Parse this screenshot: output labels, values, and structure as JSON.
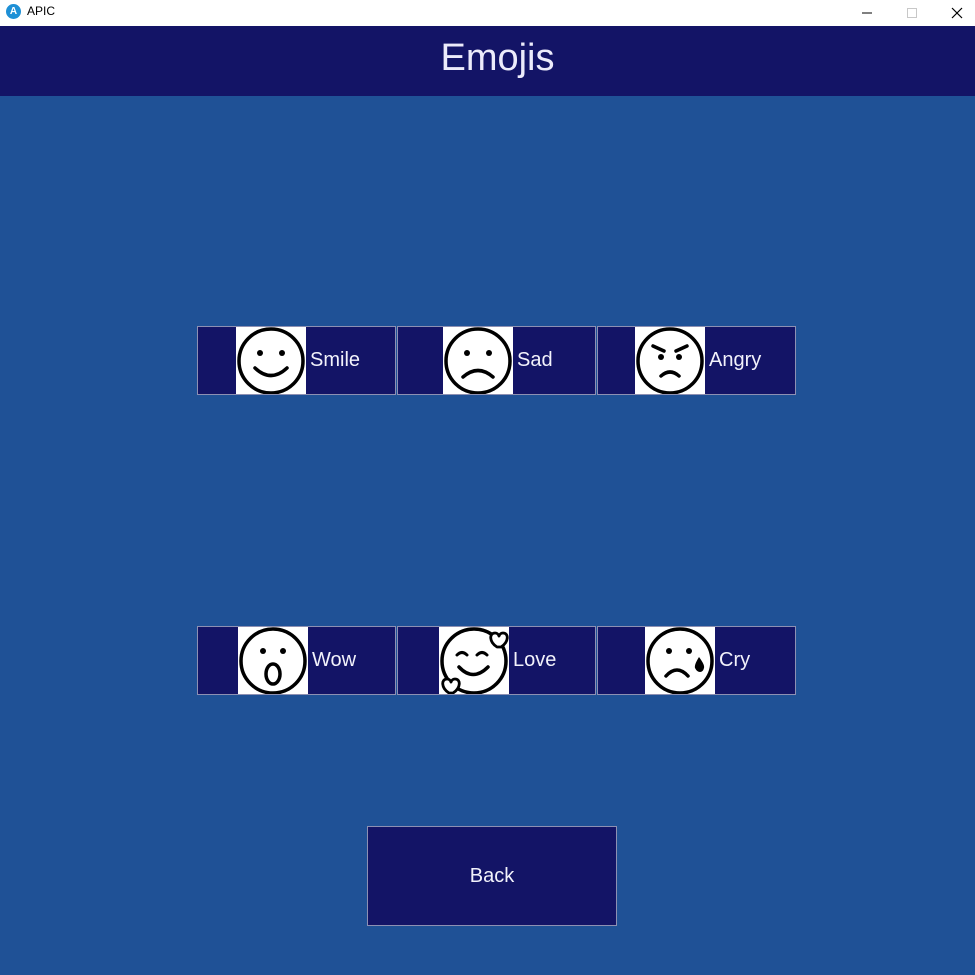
{
  "window": {
    "title": "APIC",
    "icon": "apic-app-icon",
    "controls": [
      "minimize-icon",
      "maximize-icon",
      "close-icon"
    ]
  },
  "header": {
    "title": "Emojis"
  },
  "emojis": [
    {
      "label": "Smile",
      "icon": "smile-icon"
    },
    {
      "label": "Sad",
      "icon": "sad-icon"
    },
    {
      "label": "Angry",
      "icon": "angry-icon"
    },
    {
      "label": "Wow",
      "icon": "wow-icon"
    },
    {
      "label": "Love",
      "icon": "love-icon"
    },
    {
      "label": "Cry",
      "icon": "cry-icon"
    }
  ],
  "back_button": {
    "label": "Back"
  },
  "colors": {
    "background": "#1f5196",
    "header": "#131466",
    "button": "#131466",
    "button_border": "#8d90b3",
    "text": "#f2f2fb"
  }
}
